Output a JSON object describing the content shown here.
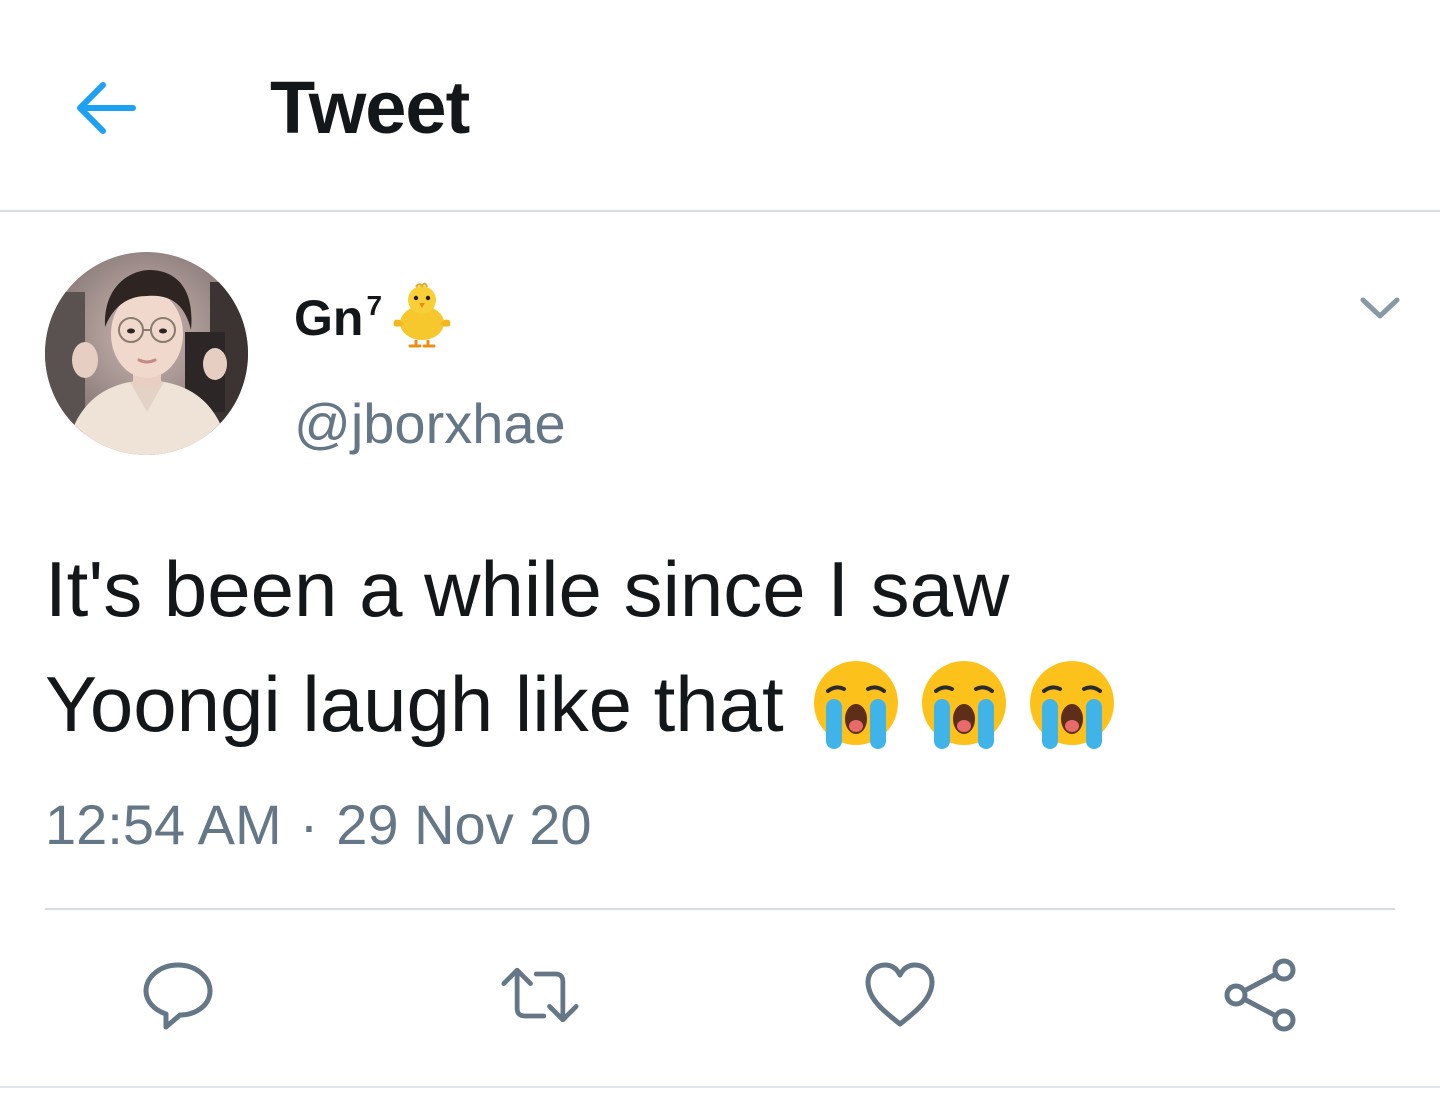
{
  "header": {
    "title": "Tweet",
    "back_icon": "arrow-left-icon"
  },
  "author": {
    "display_name": "Gn",
    "display_name_superscript": "7",
    "display_name_emoji": "chick-icon",
    "handle": "@jborxhae"
  },
  "tweet": {
    "text_line_1": "It's been a while since I saw",
    "text_line_2": "Yoongi laugh like that",
    "emojis": [
      "loudly-crying-face-icon",
      "loudly-crying-face-icon",
      "loudly-crying-face-icon"
    ],
    "time": "12:54 AM",
    "separator": "·",
    "date": "29 Nov 20"
  },
  "actions": [
    "reply-icon",
    "retweet-icon",
    "like-icon",
    "share-icon"
  ],
  "colors": {
    "accent": "#1da1f2",
    "text": "#14171a",
    "secondary_text": "#657786",
    "icon": "#657786",
    "divider": "#d9dde1"
  }
}
